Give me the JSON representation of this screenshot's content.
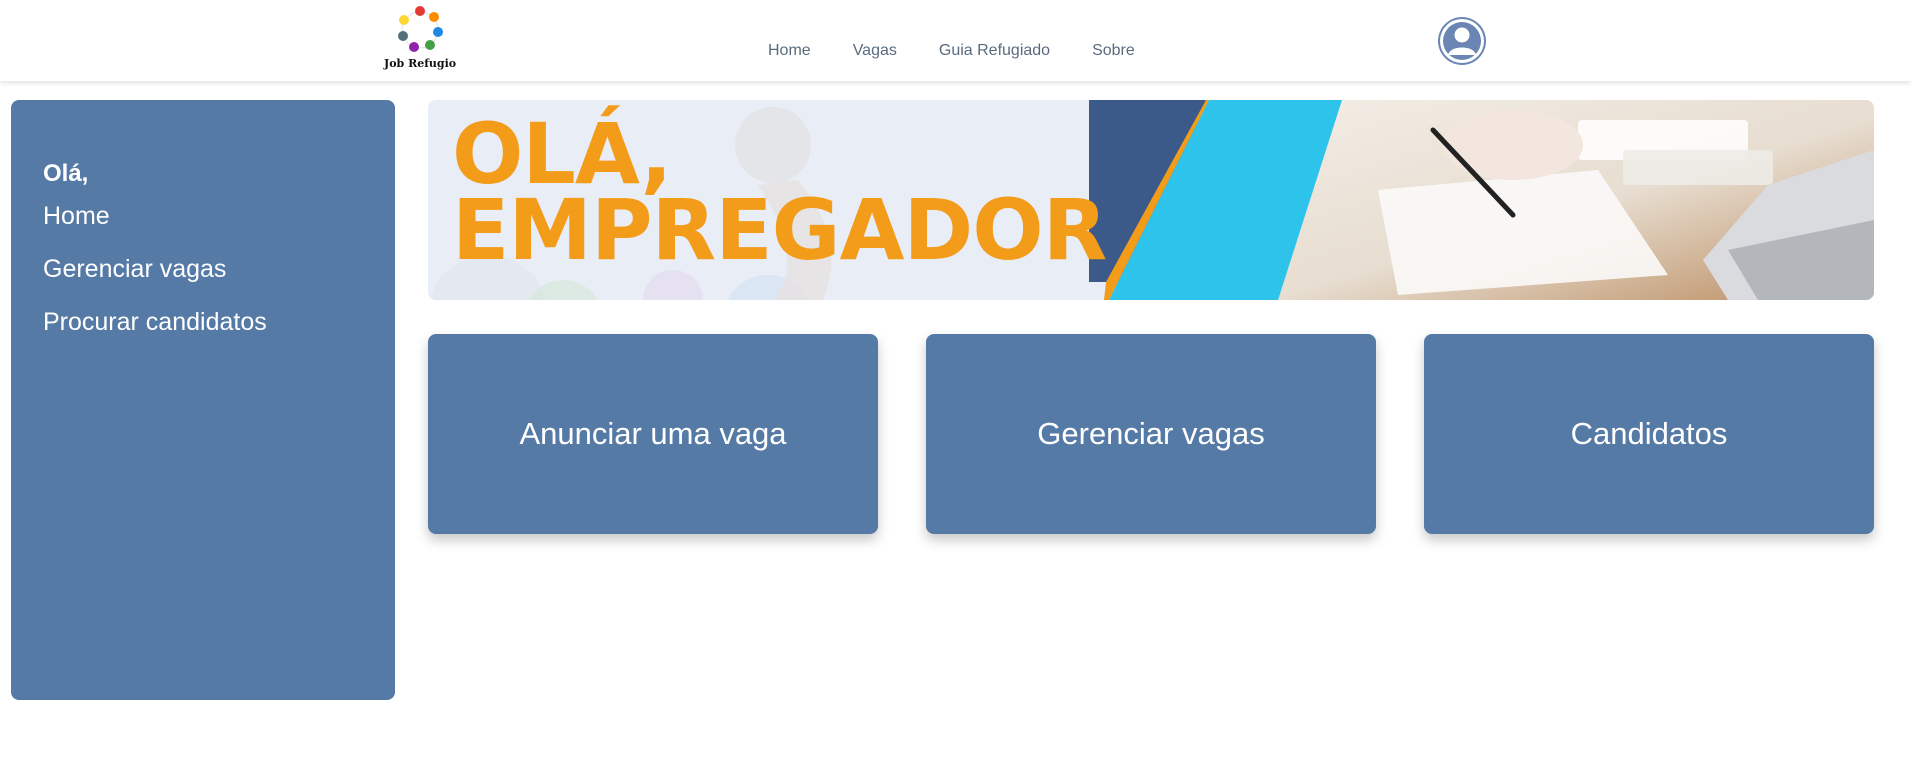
{
  "header": {
    "logo_text": "Job Refugio",
    "nav": [
      "Home",
      "Vagas",
      "Guia Refugiado",
      "Sobre"
    ]
  },
  "sidebar": {
    "greeting": "Olá,",
    "items": [
      "Home",
      "Gerenciar vagas",
      "Procurar candidatos"
    ]
  },
  "banner": {
    "line1": "OLÁ,",
    "line2": "EMPREGADOR"
  },
  "cards": [
    "Anunciar uma vaga",
    "Gerenciar vagas",
    "Candidatos"
  ],
  "colors": {
    "primary": "#557aa6",
    "accent": "#f39c1a",
    "banner_cyan": "#2ec3ea",
    "banner_navy": "#3b5a89"
  }
}
